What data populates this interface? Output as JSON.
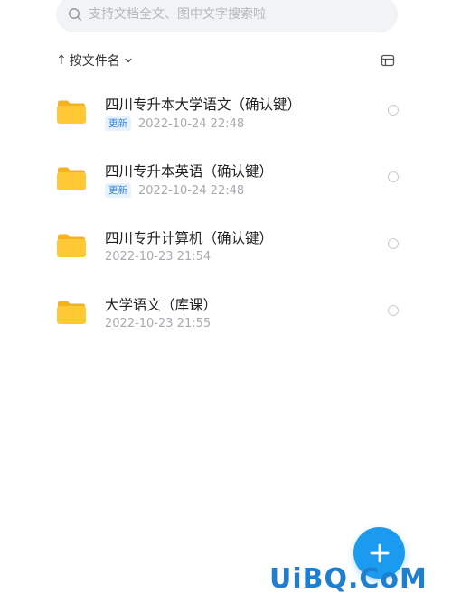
{
  "search": {
    "placeholder": "支持文档全文、图中文字搜索啦"
  },
  "sort": {
    "arrow": "↑",
    "label": "按文件名"
  },
  "files": [
    {
      "name": "四川专升本大学语文（确认键）",
      "badge": "更新",
      "time": "2022-10-24 22:48"
    },
    {
      "name": "四川专升本英语（确认键）",
      "badge": "更新",
      "time": "2022-10-24 22:48"
    },
    {
      "name": "四川专升计算机（确认键）",
      "badge": "",
      "time": "2022-10-23 21:54"
    },
    {
      "name": "大学语文（库课）",
      "badge": "",
      "time": "2022-10-23 21:55"
    }
  ],
  "icons": {
    "search": "search-icon",
    "sort_chevron": "chevron-down-icon",
    "view_toggle": "list-view-icon",
    "folder": "folder-icon",
    "fab": "plus-icon"
  },
  "colors": {
    "accent": "#1a9bf0",
    "badge_text": "#2f86e6",
    "badge_bg": "#e8f2fd",
    "folder": "#ffc533",
    "secondary_text": "#a7aab0"
  },
  "watermark": "UiBQ.CoM"
}
